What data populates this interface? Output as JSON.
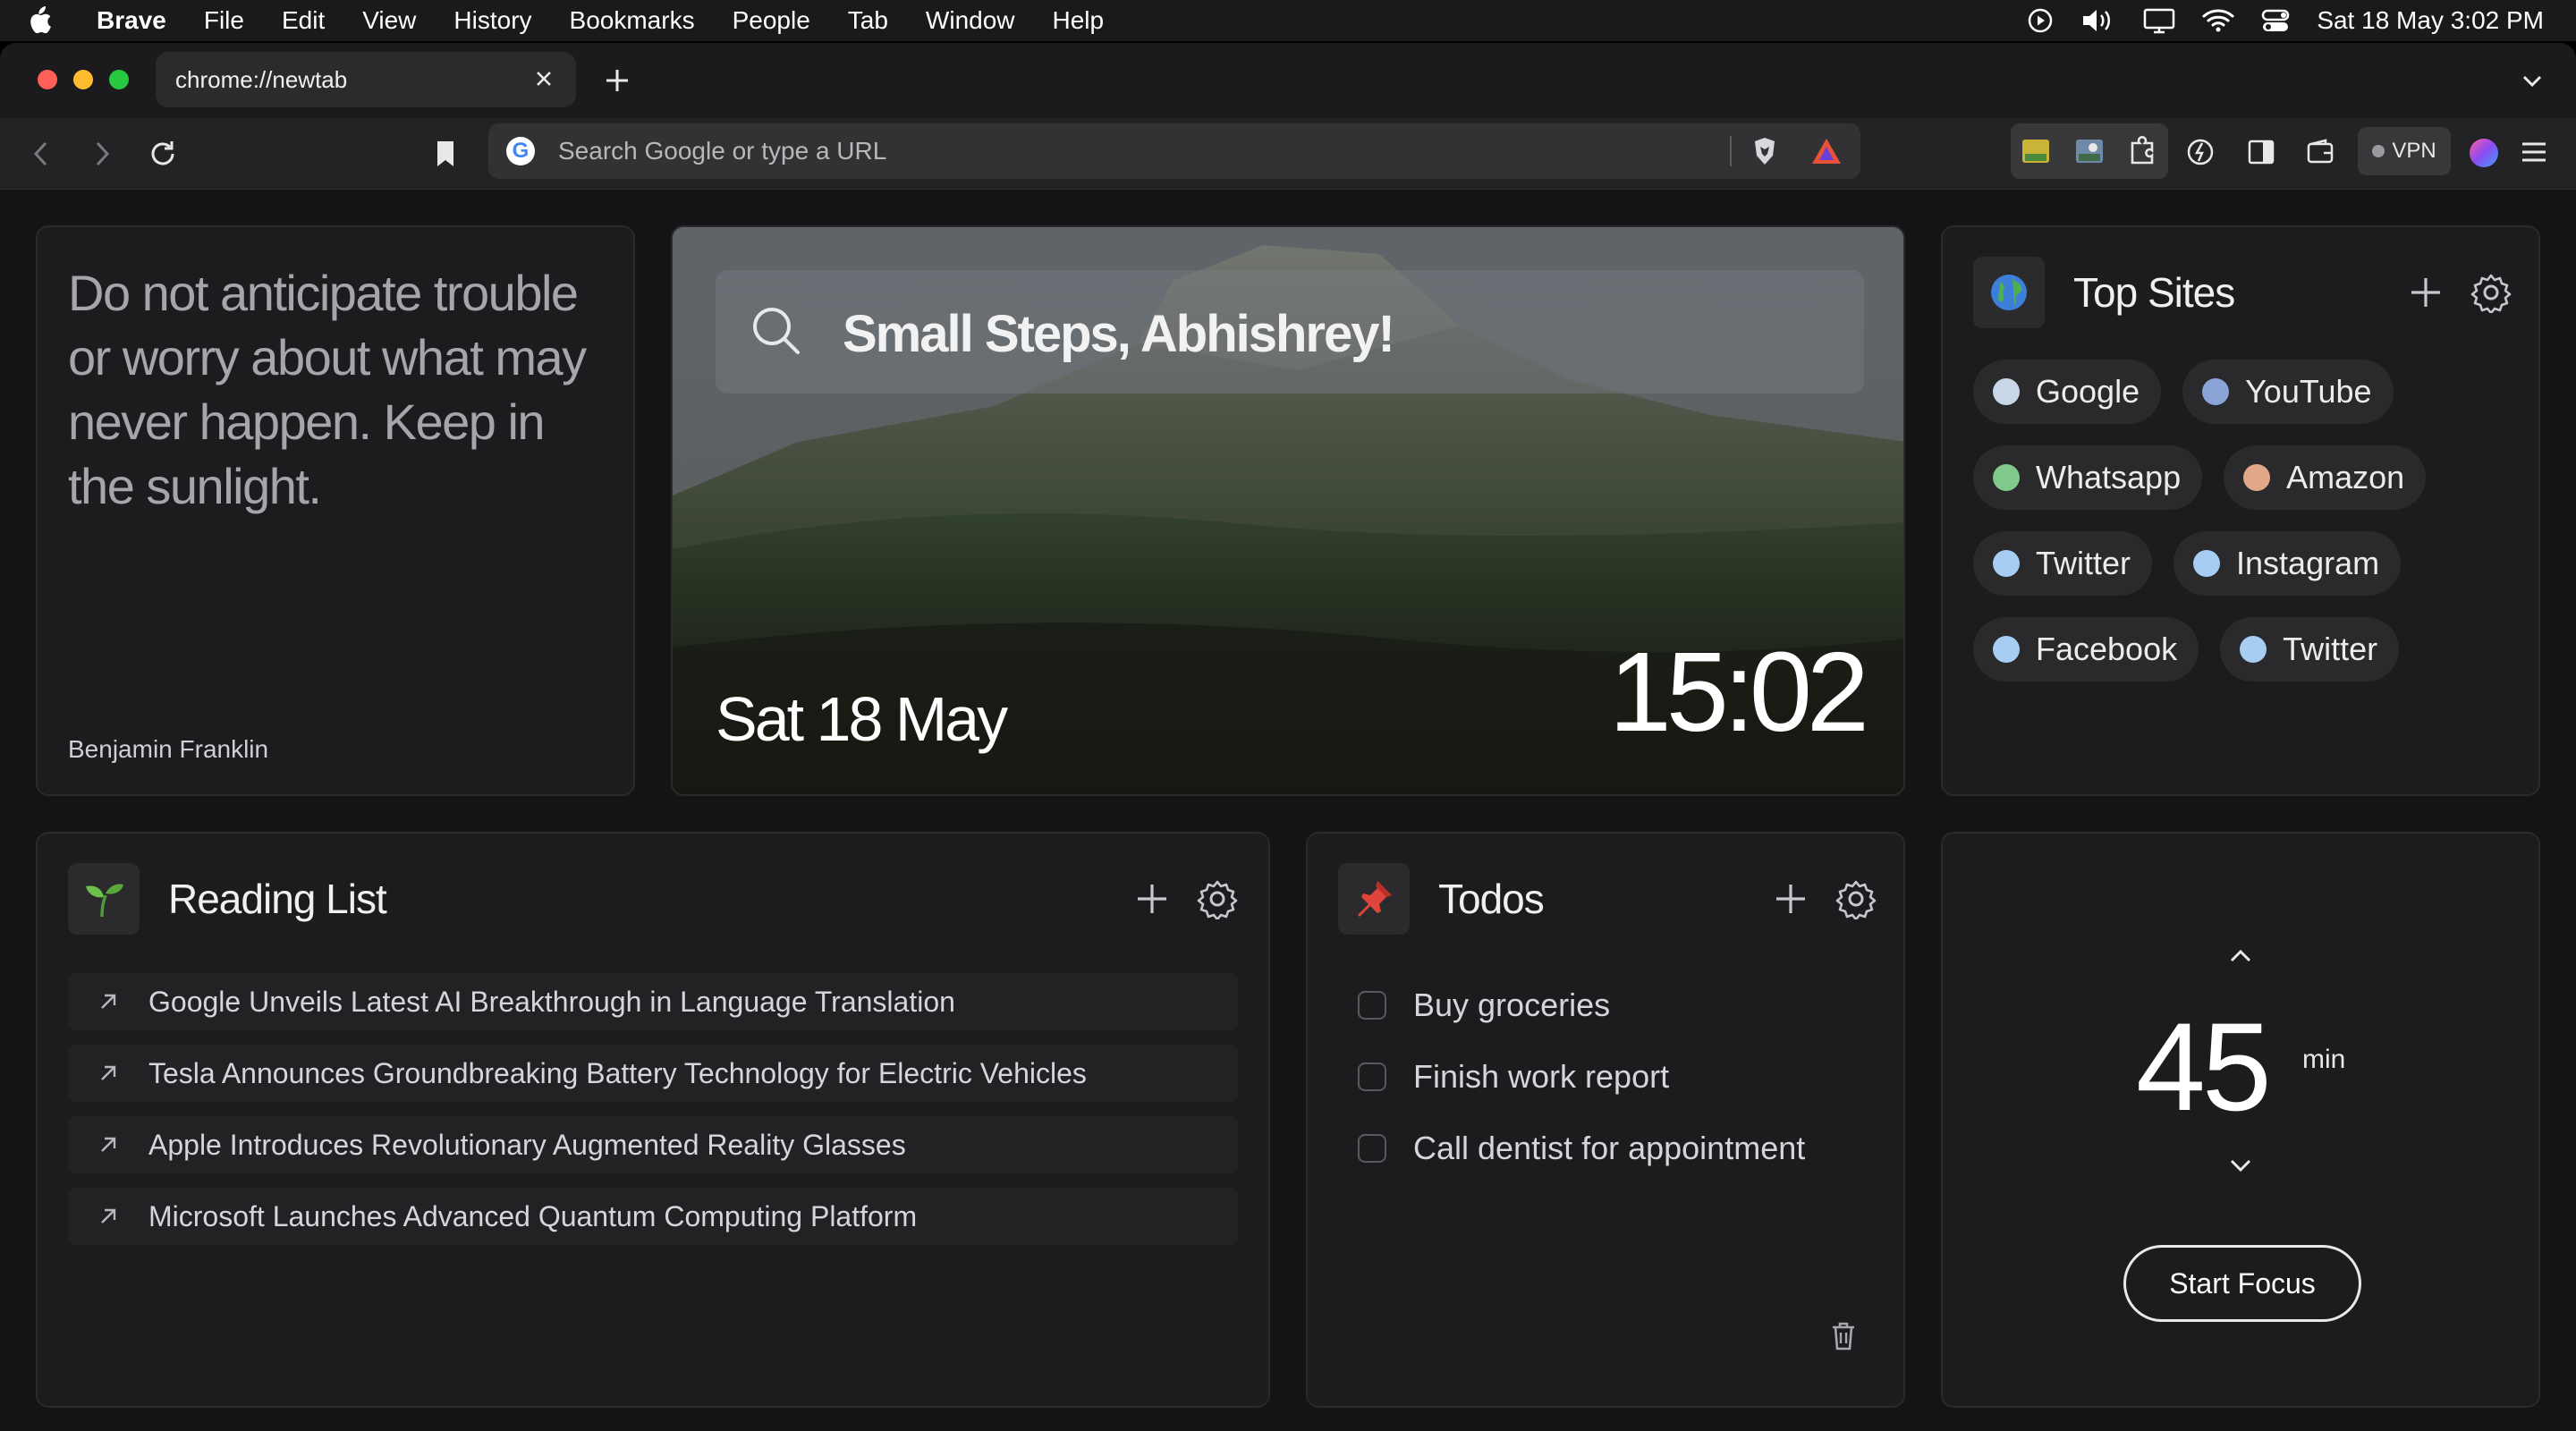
{
  "menubar": {
    "app": "Brave",
    "items": [
      "File",
      "Edit",
      "View",
      "History",
      "Bookmarks",
      "People",
      "Tab",
      "Window",
      "Help"
    ],
    "clock": "Sat 18 May  3:02 PM"
  },
  "browser": {
    "tab_title": "chrome://newtab",
    "omnibox_placeholder": "Search Google or type a URL",
    "vpn_label": "VPN"
  },
  "quote": {
    "text": "Do not anticipate trouble or worry about what may never happen. Keep in the sunlight.",
    "author": "Benjamin Franklin"
  },
  "hero": {
    "greeting": "Small Steps, Abhishrey!",
    "date": "Sat 18 May",
    "time": "15:02"
  },
  "top_sites": {
    "title": "Top Sites",
    "sites": [
      {
        "label": "Google",
        "color": "#c8d6e8"
      },
      {
        "label": "YouTube",
        "color": "#8aa4d8"
      },
      {
        "label": "Whatsapp",
        "color": "#7fc98a"
      },
      {
        "label": "Amazon",
        "color": "#e0a888"
      },
      {
        "label": "Twitter",
        "color": "#a8cdf2"
      },
      {
        "label": "Instagram",
        "color": "#a8cdf2"
      },
      {
        "label": "Facebook",
        "color": "#a8cdf2"
      },
      {
        "label": "Twitter",
        "color": "#a8cdf2"
      }
    ]
  },
  "reading_list": {
    "title": "Reading List",
    "items": [
      "Google Unveils Latest AI Breakthrough in Language Translation",
      "Tesla Announces Groundbreaking Battery Technology for Electric Vehicles",
      "Apple Introduces Revolutionary Augmented Reality Glasses",
      "Microsoft Launches Advanced Quantum Computing Platform"
    ]
  },
  "todos": {
    "title": "Todos",
    "items": [
      "Buy groceries",
      "Finish work report",
      "Call dentist for appointment"
    ]
  },
  "focus": {
    "minutes": "45",
    "unit": "min",
    "button": "Start Focus"
  }
}
